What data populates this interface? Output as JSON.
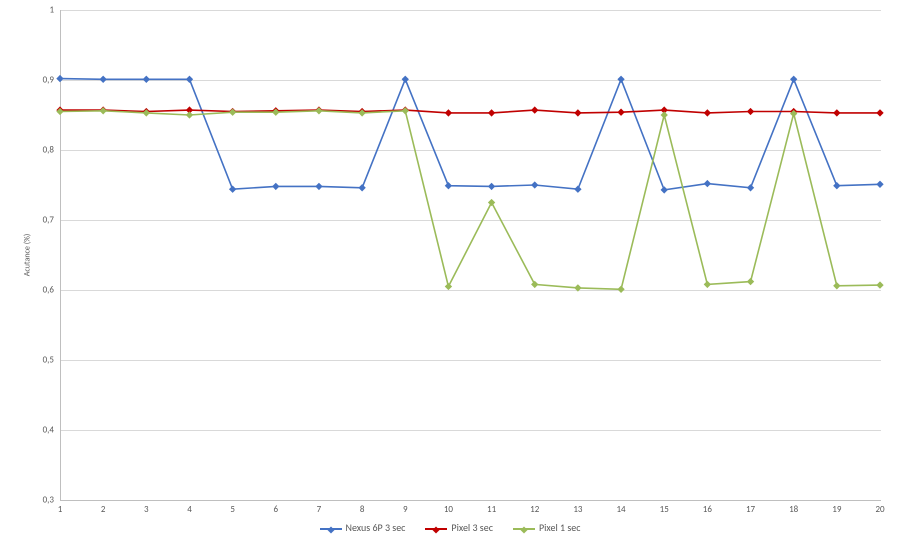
{
  "chart_data": {
    "type": "line",
    "title": "",
    "xlabel": "",
    "ylabel": "Acutance (%)",
    "ylim": [
      0.3,
      1.0
    ],
    "xlim": [
      1,
      20
    ],
    "x_ticks": [
      1,
      2,
      3,
      4,
      5,
      6,
      7,
      8,
      9,
      10,
      11,
      12,
      13,
      14,
      15,
      16,
      17,
      18,
      19,
      20
    ],
    "y_ticks": [
      0.3,
      0.4,
      0.5,
      0.6,
      0.7,
      0.8,
      0.9,
      1.0
    ],
    "y_tick_labels": [
      "0,3",
      "0,4",
      "0,5",
      "0,6",
      "0,7",
      "0,8",
      "0,9",
      "1"
    ],
    "categories": [
      1,
      2,
      3,
      4,
      5,
      6,
      7,
      8,
      9,
      10,
      11,
      12,
      13,
      14,
      15,
      16,
      17,
      18,
      19,
      20
    ],
    "series": [
      {
        "name": "Nexus 6P 3 sec",
        "color": "#4472c4",
        "values": [
          0.902,
          0.901,
          0.901,
          0.901,
          0.744,
          0.748,
          0.748,
          0.746,
          0.901,
          0.749,
          0.748,
          0.75,
          0.744,
          0.901,
          0.743,
          0.752,
          0.746,
          0.901,
          0.749,
          0.751
        ]
      },
      {
        "name": "Pixel 3 sec",
        "color": "#c00000",
        "values": [
          0.857,
          0.857,
          0.855,
          0.857,
          0.855,
          0.856,
          0.857,
          0.855,
          0.857,
          0.853,
          0.853,
          0.857,
          0.853,
          0.854,
          0.857,
          0.853,
          0.855,
          0.855,
          0.853,
          0.853
        ]
      },
      {
        "name": "Pixel 1 sec",
        "color": "#9bbb59",
        "values": [
          0.855,
          0.856,
          0.853,
          0.85,
          0.854,
          0.854,
          0.856,
          0.853,
          0.856,
          0.605,
          0.725,
          0.608,
          0.603,
          0.601,
          0.85,
          0.608,
          0.612,
          0.852,
          0.606,
          0.607
        ]
      }
    ]
  },
  "legend": {
    "items": [
      {
        "label": "Nexus 6P 3 sec",
        "color": "#4472c4"
      },
      {
        "label": "Pixel 3 sec",
        "color": "#c00000"
      },
      {
        "label": "Pixel 1 sec",
        "color": "#9bbb59"
      }
    ]
  }
}
